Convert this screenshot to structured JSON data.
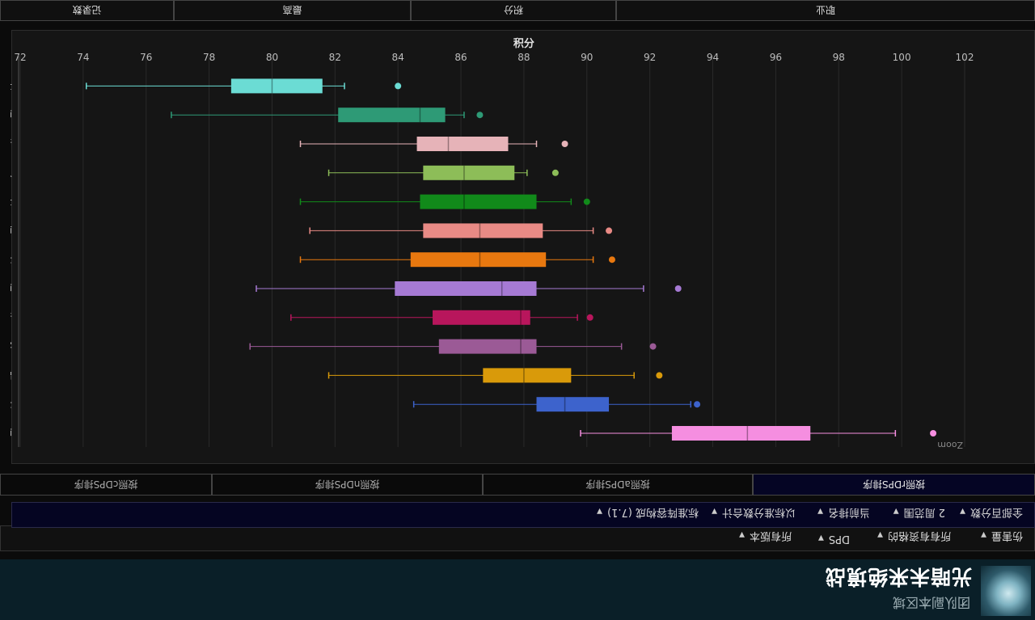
{
  "header": {
    "title": "光暗未来绝境战",
    "subtitle": "团队副本区域"
  },
  "filters_row1": [
    {
      "label": "伤害量"
    },
    {
      "label": "所有有资格的"
    },
    {
      "label": "DPS"
    },
    {
      "label": "所有版本"
    }
  ],
  "filters_row2": [
    {
      "label": "全部百分数"
    },
    {
      "label": "2 周范围"
    },
    {
      "label": "当前排名"
    },
    {
      "label": "以标准分数合计"
    },
    {
      "label": "标准阵容构成 (7.1)"
    }
  ],
  "rank_tabs": [
    {
      "label": "按照rDPS排序",
      "active": true
    },
    {
      "label": "按照aDPS排序",
      "active": false
    },
    {
      "label": "按照nDPS排序",
      "active": false
    },
    {
      "label": "按照cDPS排序",
      "active": false
    }
  ],
  "zoom_label": "Zoom",
  "bottom_tabs": [
    {
      "label": "职业"
    },
    {
      "label": "积分"
    },
    {
      "label": "最高"
    },
    {
      "label": "记录数"
    }
  ],
  "chart_data": {
    "type": "boxplot",
    "xlabel": "积分",
    "xlim": [
      72,
      102
    ],
    "ticks": [
      72,
      74,
      76,
      78,
      80,
      82,
      84,
      86,
      88,
      90,
      92,
      94,
      96,
      98,
      100,
      102
    ],
    "categories": [
      {
        "name": "机工士",
        "min": 74.1,
        "q1": 78.7,
        "median": 80.0,
        "q3": 81.6,
        "max": 82.3,
        "outlier": 84.0,
        "color": "#6bdcd4"
      },
      {
        "name": "召唤师",
        "min": 76.8,
        "q1": 82.1,
        "median": 84.7,
        "q3": 85.5,
        "max": 86.1,
        "outlier": 86.6,
        "color": "#2e9a76"
      },
      {
        "name": "舞者",
        "min": 80.9,
        "q1": 84.6,
        "median": 85.6,
        "q3": 87.5,
        "max": 88.4,
        "outlier": 89.3,
        "color": "#e6b3b8"
      },
      {
        "name": "吟游诗人",
        "min": 81.8,
        "q1": 84.8,
        "median": 86.1,
        "q3": 87.7,
        "max": 88.1,
        "outlier": 89.0,
        "color": "#8dbd58"
      },
      {
        "name": "蝰蛇剑士",
        "min": 80.9,
        "q1": 84.7,
        "median": 86.1,
        "q3": 88.4,
        "max": 89.5,
        "outlier": 90.0,
        "color": "#118a1a"
      },
      {
        "name": "赤魔法师",
        "min": 81.2,
        "q1": 84.8,
        "median": 86.6,
        "q3": 88.6,
        "max": 90.2,
        "outlier": 90.7,
        "color": "#e88a85"
      },
      {
        "name": "武士",
        "min": 80.9,
        "q1": 84.4,
        "median": 86.6,
        "q3": 88.7,
        "max": 90.2,
        "outlier": 90.8,
        "color": "#e8780f"
      },
      {
        "name": "黑魔法师",
        "min": 79.5,
        "q1": 83.9,
        "median": 87.3,
        "q3": 88.4,
        "max": 91.8,
        "outlier": 92.9,
        "color": "#a67ad4"
      },
      {
        "name": "忍者",
        "min": 80.6,
        "q1": 85.1,
        "median": 87.9,
        "q3": 88.2,
        "max": 89.7,
        "outlier": 90.1,
        "color": "#b8165c"
      },
      {
        "name": "钐镰客",
        "min": 79.3,
        "q1": 85.3,
        "median": 87.9,
        "q3": 88.4,
        "max": 91.1,
        "outlier": 92.1,
        "color": "#9b5a96"
      },
      {
        "name": "武僧",
        "min": 81.8,
        "q1": 86.7,
        "median": 88.0,
        "q3": 89.5,
        "max": 91.5,
        "outlier": 92.3,
        "color": "#d99a0a"
      },
      {
        "name": "龙骑士",
        "min": 84.5,
        "q1": 88.4,
        "median": 89.3,
        "q3": 90.7,
        "max": 93.3,
        "outlier": 93.5,
        "color": "#3d63cc"
      },
      {
        "name": "绘灵法师",
        "min": 89.8,
        "q1": 92.7,
        "median": 95.1,
        "q3": 97.1,
        "max": 99.8,
        "outlier": 101.0,
        "color": "#f58ee0"
      }
    ]
  }
}
